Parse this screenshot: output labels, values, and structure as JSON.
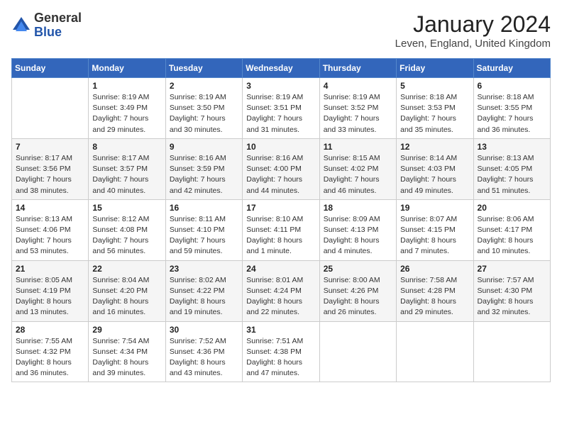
{
  "header": {
    "logo_general": "General",
    "logo_blue": "Blue",
    "month_title": "January 2024",
    "location": "Leven, England, United Kingdom"
  },
  "days_of_week": [
    "Sunday",
    "Monday",
    "Tuesday",
    "Wednesday",
    "Thursday",
    "Friday",
    "Saturday"
  ],
  "weeks": [
    [
      {
        "day": "",
        "info": ""
      },
      {
        "day": "1",
        "info": "Sunrise: 8:19 AM\nSunset: 3:49 PM\nDaylight: 7 hours\nand 29 minutes."
      },
      {
        "day": "2",
        "info": "Sunrise: 8:19 AM\nSunset: 3:50 PM\nDaylight: 7 hours\nand 30 minutes."
      },
      {
        "day": "3",
        "info": "Sunrise: 8:19 AM\nSunset: 3:51 PM\nDaylight: 7 hours\nand 31 minutes."
      },
      {
        "day": "4",
        "info": "Sunrise: 8:19 AM\nSunset: 3:52 PM\nDaylight: 7 hours\nand 33 minutes."
      },
      {
        "day": "5",
        "info": "Sunrise: 8:18 AM\nSunset: 3:53 PM\nDaylight: 7 hours\nand 35 minutes."
      },
      {
        "day": "6",
        "info": "Sunrise: 8:18 AM\nSunset: 3:55 PM\nDaylight: 7 hours\nand 36 minutes."
      }
    ],
    [
      {
        "day": "7",
        "info": "Sunrise: 8:17 AM\nSunset: 3:56 PM\nDaylight: 7 hours\nand 38 minutes."
      },
      {
        "day": "8",
        "info": "Sunrise: 8:17 AM\nSunset: 3:57 PM\nDaylight: 7 hours\nand 40 minutes."
      },
      {
        "day": "9",
        "info": "Sunrise: 8:16 AM\nSunset: 3:59 PM\nDaylight: 7 hours\nand 42 minutes."
      },
      {
        "day": "10",
        "info": "Sunrise: 8:16 AM\nSunset: 4:00 PM\nDaylight: 7 hours\nand 44 minutes."
      },
      {
        "day": "11",
        "info": "Sunrise: 8:15 AM\nSunset: 4:02 PM\nDaylight: 7 hours\nand 46 minutes."
      },
      {
        "day": "12",
        "info": "Sunrise: 8:14 AM\nSunset: 4:03 PM\nDaylight: 7 hours\nand 49 minutes."
      },
      {
        "day": "13",
        "info": "Sunrise: 8:13 AM\nSunset: 4:05 PM\nDaylight: 7 hours\nand 51 minutes."
      }
    ],
    [
      {
        "day": "14",
        "info": "Sunrise: 8:13 AM\nSunset: 4:06 PM\nDaylight: 7 hours\nand 53 minutes."
      },
      {
        "day": "15",
        "info": "Sunrise: 8:12 AM\nSunset: 4:08 PM\nDaylight: 7 hours\nand 56 minutes."
      },
      {
        "day": "16",
        "info": "Sunrise: 8:11 AM\nSunset: 4:10 PM\nDaylight: 7 hours\nand 59 minutes."
      },
      {
        "day": "17",
        "info": "Sunrise: 8:10 AM\nSunset: 4:11 PM\nDaylight: 8 hours\nand 1 minute."
      },
      {
        "day": "18",
        "info": "Sunrise: 8:09 AM\nSunset: 4:13 PM\nDaylight: 8 hours\nand 4 minutes."
      },
      {
        "day": "19",
        "info": "Sunrise: 8:07 AM\nSunset: 4:15 PM\nDaylight: 8 hours\nand 7 minutes."
      },
      {
        "day": "20",
        "info": "Sunrise: 8:06 AM\nSunset: 4:17 PM\nDaylight: 8 hours\nand 10 minutes."
      }
    ],
    [
      {
        "day": "21",
        "info": "Sunrise: 8:05 AM\nSunset: 4:19 PM\nDaylight: 8 hours\nand 13 minutes."
      },
      {
        "day": "22",
        "info": "Sunrise: 8:04 AM\nSunset: 4:20 PM\nDaylight: 8 hours\nand 16 minutes."
      },
      {
        "day": "23",
        "info": "Sunrise: 8:02 AM\nSunset: 4:22 PM\nDaylight: 8 hours\nand 19 minutes."
      },
      {
        "day": "24",
        "info": "Sunrise: 8:01 AM\nSunset: 4:24 PM\nDaylight: 8 hours\nand 22 minutes."
      },
      {
        "day": "25",
        "info": "Sunrise: 8:00 AM\nSunset: 4:26 PM\nDaylight: 8 hours\nand 26 minutes."
      },
      {
        "day": "26",
        "info": "Sunrise: 7:58 AM\nSunset: 4:28 PM\nDaylight: 8 hours\nand 29 minutes."
      },
      {
        "day": "27",
        "info": "Sunrise: 7:57 AM\nSunset: 4:30 PM\nDaylight: 8 hours\nand 32 minutes."
      }
    ],
    [
      {
        "day": "28",
        "info": "Sunrise: 7:55 AM\nSunset: 4:32 PM\nDaylight: 8 hours\nand 36 minutes."
      },
      {
        "day": "29",
        "info": "Sunrise: 7:54 AM\nSunset: 4:34 PM\nDaylight: 8 hours\nand 39 minutes."
      },
      {
        "day": "30",
        "info": "Sunrise: 7:52 AM\nSunset: 4:36 PM\nDaylight: 8 hours\nand 43 minutes."
      },
      {
        "day": "31",
        "info": "Sunrise: 7:51 AM\nSunset: 4:38 PM\nDaylight: 8 hours\nand 47 minutes."
      },
      {
        "day": "",
        "info": ""
      },
      {
        "day": "",
        "info": ""
      },
      {
        "day": "",
        "info": ""
      }
    ]
  ]
}
